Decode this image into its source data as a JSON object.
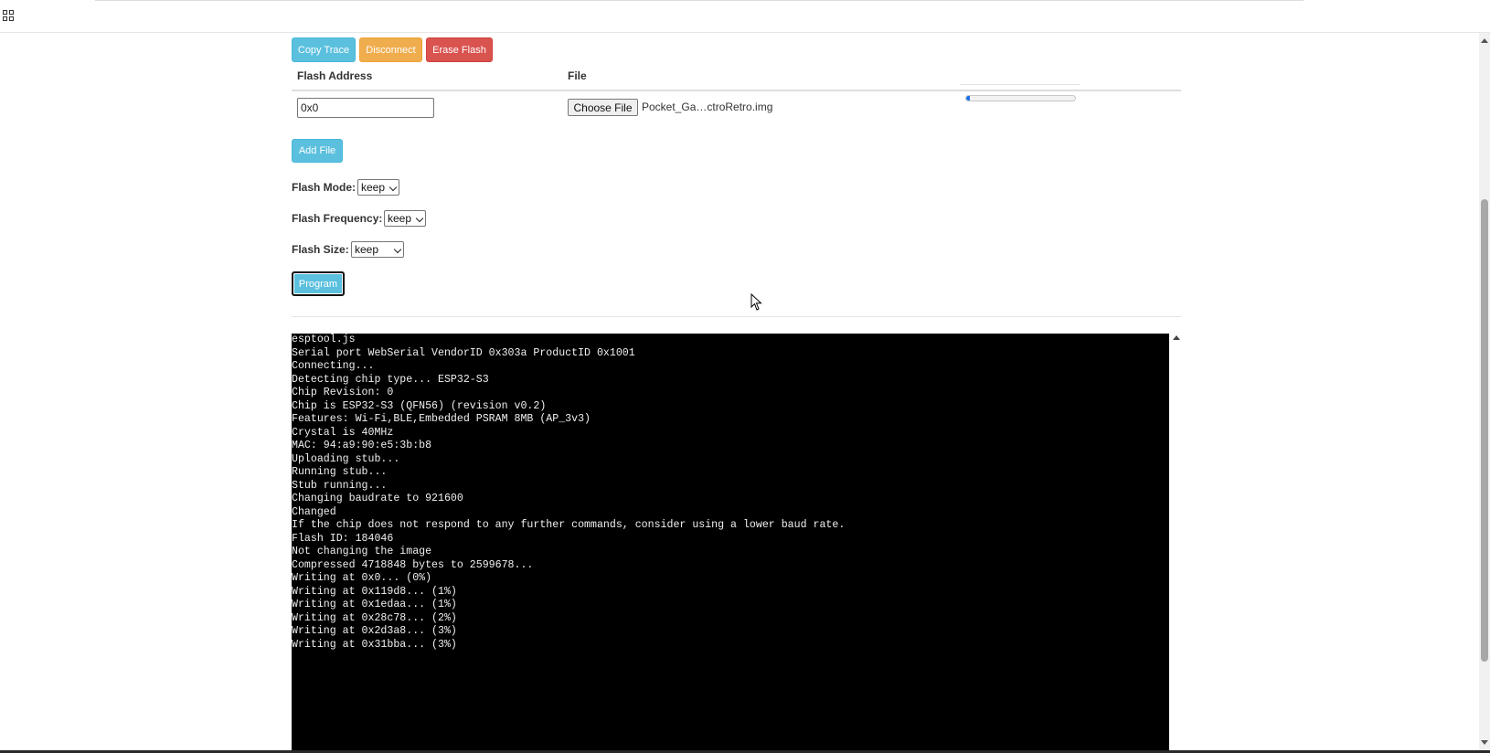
{
  "toolbar": {
    "copy_trace_label": "Copy Trace",
    "disconnect_label": "Disconnect",
    "erase_flash_label": "Erase Flash"
  },
  "colors": {
    "info": "#5bc0de",
    "warning": "#f0ad4e",
    "danger": "#d9534f",
    "console_bg": "#000000",
    "console_text": "#f0f0f0",
    "progress": "#1a73e8"
  },
  "file_table": {
    "headers": [
      "Flash Address",
      "File"
    ],
    "rows": [
      {
        "address": "0x0",
        "choose_file_label": "Choose File",
        "file_name": "Pocket_Ga…ctroRetro.img",
        "progress_fraction": 0.03
      }
    ]
  },
  "add_file_label": "Add File",
  "flash_mode": {
    "label": "Flash Mode:",
    "value": "keep"
  },
  "flash_frequency": {
    "label": "Flash Frequency:",
    "value": "keep"
  },
  "flash_size": {
    "label": "Flash Size:",
    "value": "keep"
  },
  "program_label": "Program",
  "console": {
    "lines": [
      "esptool.js",
      "Serial port WebSerial VendorID 0x303a ProductID 0x1001",
      "Connecting...",
      "Detecting chip type... ESP32-S3",
      "Chip Revision: 0",
      "Chip is ESP32-S3 (QFN56) (revision v0.2)",
      "Features: Wi-Fi,BLE,Embedded PSRAM 8MB (AP_3v3)",
      "Crystal is 40MHz",
      "MAC: 94:a9:90:e5:3b:b8",
      "Uploading stub...",
      "Running stub...",
      "Stub running...",
      "Changing baudrate to 921600",
      "Changed",
      "If the chip does not respond to any further commands, consider using a lower baud rate.",
      "Flash ID: 184046",
      "Not changing the image",
      "Compressed 4718848 bytes to 2599678...",
      "Writing at 0x0... (0%)",
      "Writing at 0x119d8... (1%)",
      "Writing at 0x1edaa... (1%)",
      "Writing at 0x28c78... (2%)",
      "Writing at 0x2d3a8... (3%)",
      "Writing at 0x31bba... (3%)"
    ]
  }
}
